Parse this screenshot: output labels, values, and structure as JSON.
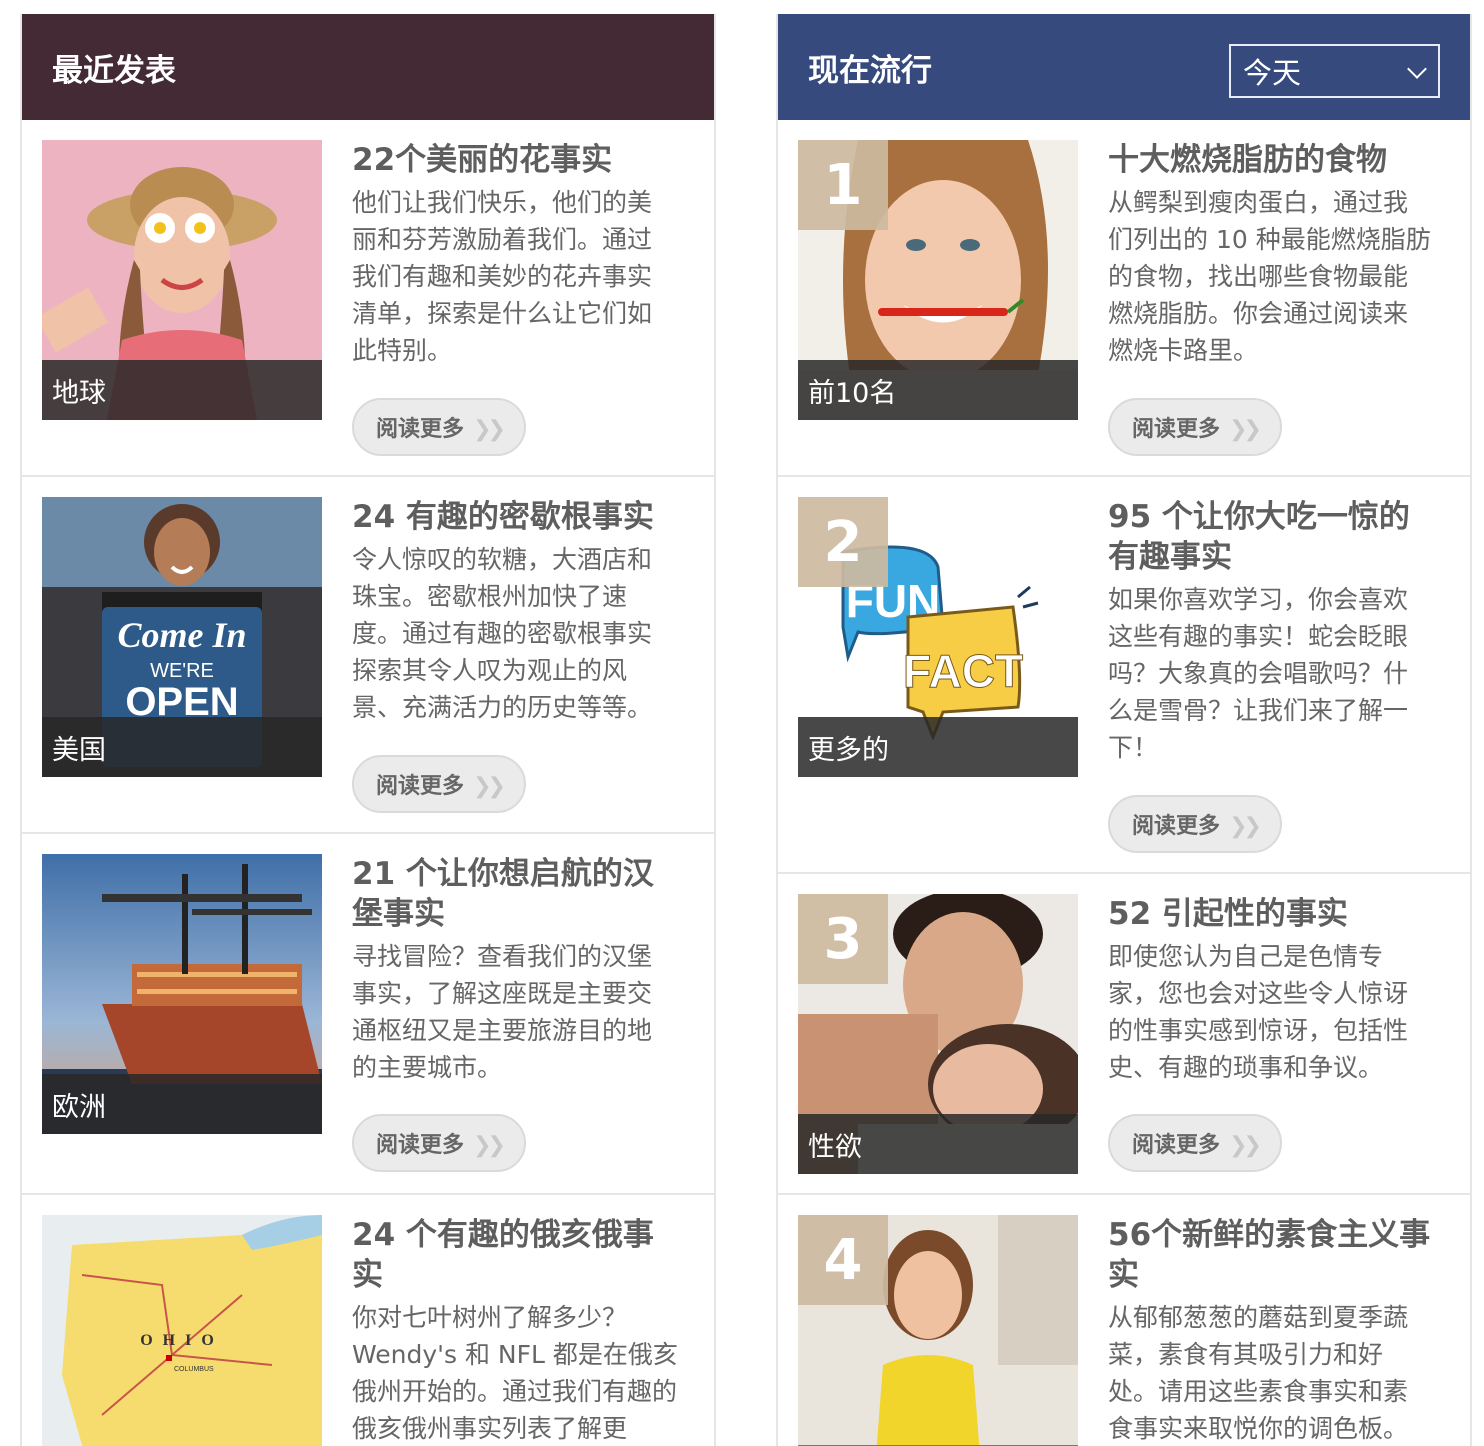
{
  "recent": {
    "title": "最近发表",
    "read_more": "阅读更多",
    "items": [
      {
        "category": "地球",
        "title": "22个美丽的花事实",
        "desc": "他们让我们快乐，他们的美丽和芬芳激励着我们。通过我们有趣和美妙的花卉事实清单，探索是什么让它们如此特别。"
      },
      {
        "category": "美国",
        "title": "24 有趣的密歇根事实",
        "desc": "令人惊叹的软糖，大酒店和珠宝。密歇根州加快了速度。通过有趣的密歇根事实探索其令人叹为观止的风景、充满活力的历史等等。",
        "sign_line1": "Come In",
        "sign_line2": "WE'RE",
        "sign_line3": "OPEN"
      },
      {
        "category": "欧洲",
        "title": "21 个让你想启航的汉堡事实",
        "desc": "寻找冒险？查看我们的汉堡事实，了解这座既是主要交通枢纽又是主要旅游目的地的主要城市。"
      },
      {
        "category": "",
        "title": "24 个有趣的俄亥俄事实",
        "desc": "你对七叶树州了解多少？Wendy's 和 NFL 都是在俄亥俄州开始的。通过我们有趣的俄亥俄州事实列表了解更",
        "map_state": "OHIO",
        "map_city": "COLUMBUS"
      }
    ]
  },
  "trending": {
    "title": "现在流行",
    "period": "今天",
    "read_more": "阅读更多",
    "items": [
      {
        "rank": "1",
        "category": "前10名",
        "title": "十大燃烧脂肪的食物",
        "desc": "从鳄梨到瘦肉蛋白，通过我们列出的 10 种最能燃烧脂肪的食物，找出哪些食物最能燃烧脂肪。你会通过阅读来燃烧卡路里。"
      },
      {
        "rank": "2",
        "category": "更多的",
        "title": "95 个让你大吃一惊的有趣事实",
        "desc": "如果你喜欢学习，你会喜欢这些有趣的事实！蛇会眨眼吗？大象真的会唱歌吗？什么是雪骨？让我们来了解一下！",
        "img_text1": "FUN",
        "img_text2": "FACT"
      },
      {
        "rank": "3",
        "category": "性欲",
        "title": "52 引起性的事实",
        "desc": "即使您认为自己是色情专家，您也会对这些令人惊讶的性事实感到惊讶，包括性史、有趣的琐事和争议。"
      },
      {
        "rank": "4",
        "category": "",
        "title": "56个新鲜的素食主义事实",
        "desc": "从郁郁葱葱的蘑菇到夏季蔬菜，素食有其吸引力和好处。请用这些素食事实和素食事实来取悦你的调色板。"
      }
    ]
  }
}
